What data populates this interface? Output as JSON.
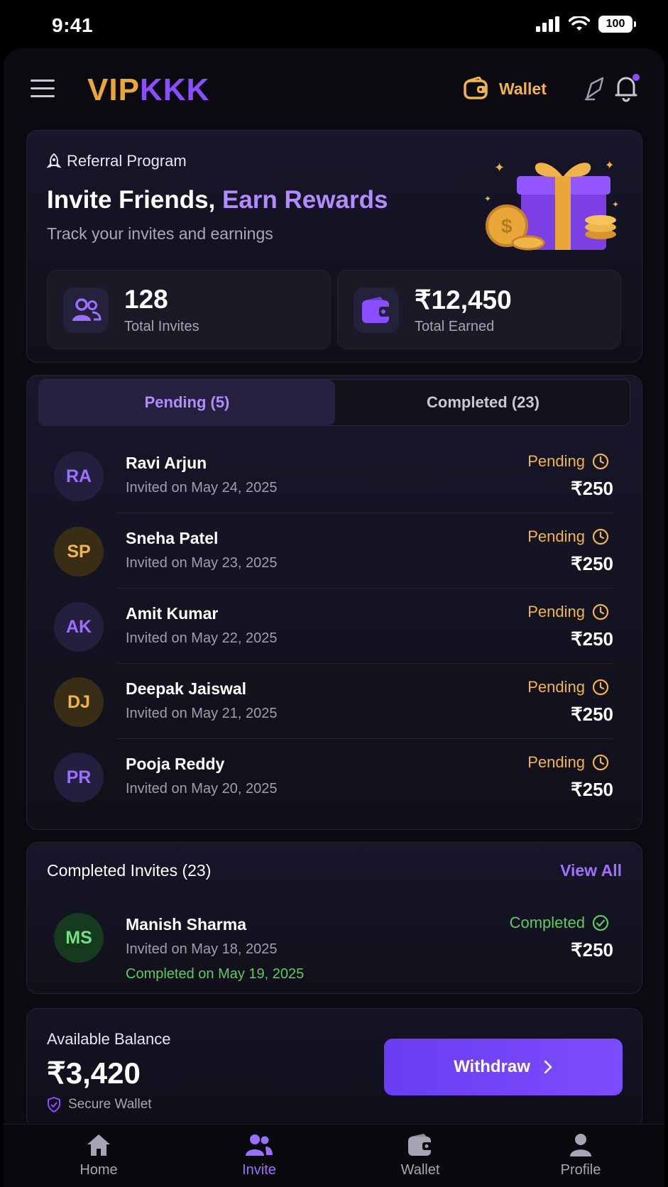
{
  "status_bar": {
    "time": "9:41",
    "battery": "100"
  },
  "header": {
    "logo_part1": "VIP",
    "logo_part2": "KKK",
    "wallet_label": "Wallet"
  },
  "hero": {
    "eyebrow": "Referral Program",
    "title_plain": "Invite Friends, ",
    "title_accent": "Earn Rewards",
    "subtitle": "Track your invites and earnings",
    "stats": [
      {
        "value": "128",
        "label": "Total Invites",
        "icon": "users-icon"
      },
      {
        "value": "₹12,450",
        "label": "Total Earned",
        "icon": "wallet-icon"
      }
    ]
  },
  "tabs": [
    {
      "label": "Pending (5)",
      "active": true
    },
    {
      "label": "Completed (23)",
      "active": false
    }
  ],
  "pending_invites": [
    {
      "initials": "RA",
      "name": "Ravi Arjun",
      "date": "Invited on May 24, 2025",
      "status": "Pending",
      "amount": "₹250",
      "color": "purple"
    },
    {
      "initials": "SP",
      "name": "Sneha Patel",
      "date": "Invited on May 23, 2025",
      "status": "Pending",
      "amount": "₹250",
      "color": "gold"
    },
    {
      "initials": "AK",
      "name": "Amit Kumar",
      "date": "Invited on May 22, 2025",
      "status": "Pending",
      "amount": "₹250",
      "color": "purple"
    },
    {
      "initials": "DJ",
      "name": "Deepak Jaiswal",
      "date": "Invited on May 21, 2025",
      "status": "Pending",
      "amount": "₹250",
      "color": "gold"
    },
    {
      "initials": "PR",
      "name": "Pooja Reddy",
      "date": "Invited on May 20, 2025",
      "status": "Pending",
      "amount": "₹250",
      "color": "purple"
    }
  ],
  "completed_section": {
    "title": "Completed Invites (23)",
    "view_all": "View All",
    "item": {
      "initials": "MS",
      "name": "Manish Sharma",
      "date": "Invited on May 18, 2025",
      "completed_on": "Completed on May 19, 2025",
      "status": "Completed",
      "amount": "₹250"
    }
  },
  "balance": {
    "label": "Available Balance",
    "amount": "₹3,420",
    "secure": "Secure Wallet",
    "withdraw": "Withdraw"
  },
  "bottom_nav": [
    {
      "label": "Home",
      "icon": "home-icon",
      "active": false
    },
    {
      "label": "Invite",
      "icon": "users-icon",
      "active": true
    },
    {
      "label": "Wallet",
      "icon": "wallet-icon",
      "active": false
    },
    {
      "label": "Profile",
      "icon": "person-icon",
      "active": false
    }
  ],
  "colors": {
    "accent": "#8a4dff",
    "gold": "#f0b54a",
    "success": "#5fc962",
    "background": "#0b0a10"
  }
}
